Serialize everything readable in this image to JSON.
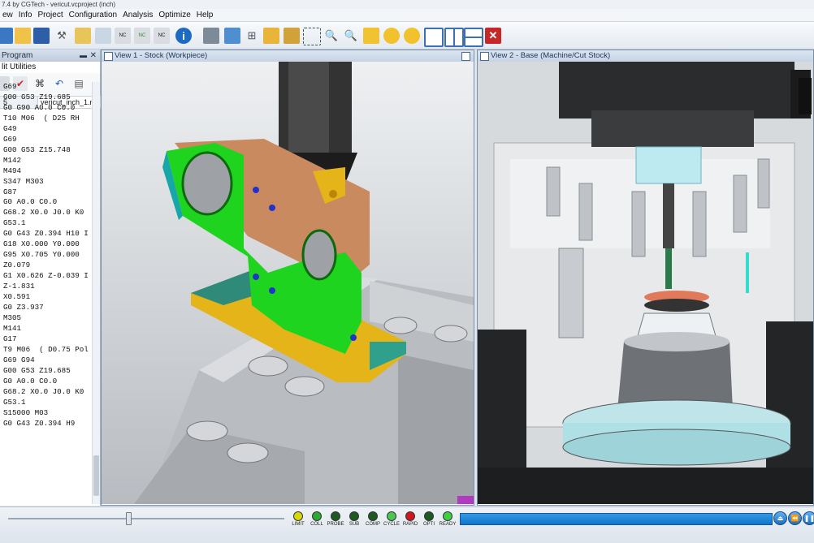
{
  "window": {
    "title": "7.4 by CGTech - vericut.vcproject (inch)"
  },
  "menu": [
    "ew",
    "Info",
    "Project",
    "Configuration",
    "Analysis",
    "Optimize",
    "Help"
  ],
  "left_panel": {
    "title": "Program",
    "menu": "lit  Utilities",
    "tab_left": "5",
    "tab_file": "vericut_inch_1.nc",
    "code_lines": [
      "G69",
      "G00 G53 Z19.685",
      "G0 G90 A0.0 C0.0",
      "T10 M06  ( D25 RH",
      "G49",
      "G69",
      "G00 G53 Z15.748",
      "M142",
      "M494",
      "S347 M303",
      "G87",
      "G0 A0.0 C0.0",
      "G68.2 X0.0 J0.0 K0",
      "G53.1",
      "G0 G43 Z0.394 H10 I",
      "G18 X0.000 Y0.000",
      "G95 X0.705 Y0.000",
      "Z0.079",
      "G1 X0.626 Z-0.039 I",
      "Z-1.831",
      "X0.591",
      "G0 Z3.937",
      "M305",
      "M141",
      "G17",
      "T9 M06  ( D0.75 Pol",
      "G69 G94",
      "G00 G53 Z19.685",
      "G0 A0.0 C0.0",
      "G68.2 X0.0 J0.0 K0",
      "G53.1",
      "S15000 M03",
      "G0 G43 Z0.394 H9"
    ]
  },
  "view1": {
    "title": "View 1 - Stock (Workpiece)"
  },
  "view2": {
    "title": "View 2 - Base (Machine/Cut Stock)"
  },
  "status": {
    "leds": [
      {
        "label": "LIMIT",
        "color": "#d8d800"
      },
      {
        "label": "COLL",
        "color": "#2fa82f"
      },
      {
        "label": "PROBE",
        "color": "#1e5a1e"
      },
      {
        "label": "SUB",
        "color": "#1e5a1e"
      },
      {
        "label": "COMP",
        "color": "#1e5a1e"
      },
      {
        "label": "CYCLE",
        "color": "#4bc84b"
      },
      {
        "label": "RAPID",
        "color": "#d01818"
      },
      {
        "label": "OPTI",
        "color": "#1e5a1e"
      },
      {
        "label": "READY",
        "color": "#3fd03f"
      }
    ],
    "progress": 1.0
  }
}
